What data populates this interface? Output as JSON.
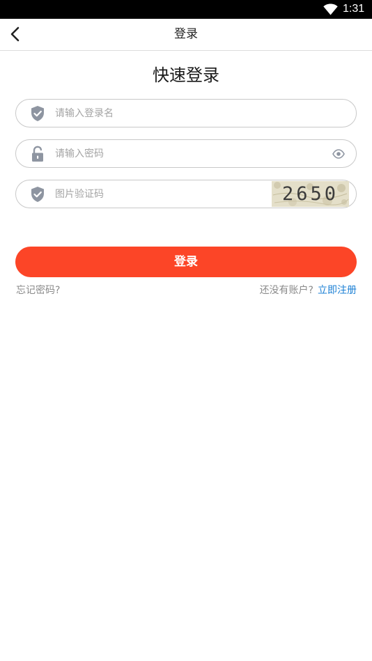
{
  "status_bar": {
    "time": "1:31"
  },
  "nav": {
    "title": "登录",
    "back_icon": "chevron-left-icon"
  },
  "heading": "快速登录",
  "fields": {
    "username": {
      "placeholder": "请输入登录名",
      "value": "",
      "icon": "shield-check-icon"
    },
    "password": {
      "placeholder": "请输入密码",
      "value": "",
      "icon": "lock-icon",
      "toggle_icon": "eye-icon"
    },
    "captcha": {
      "placeholder": "图片验证码",
      "value": "",
      "icon": "shield-check-icon",
      "image_text": "2650"
    }
  },
  "login_button": {
    "label": "登录",
    "color": "#fc4527"
  },
  "forgot": {
    "label": "忘记密码?"
  },
  "register": {
    "prompt": "还没有账户?",
    "link_label": "立即注册",
    "link_color": "#1a7fd4"
  }
}
